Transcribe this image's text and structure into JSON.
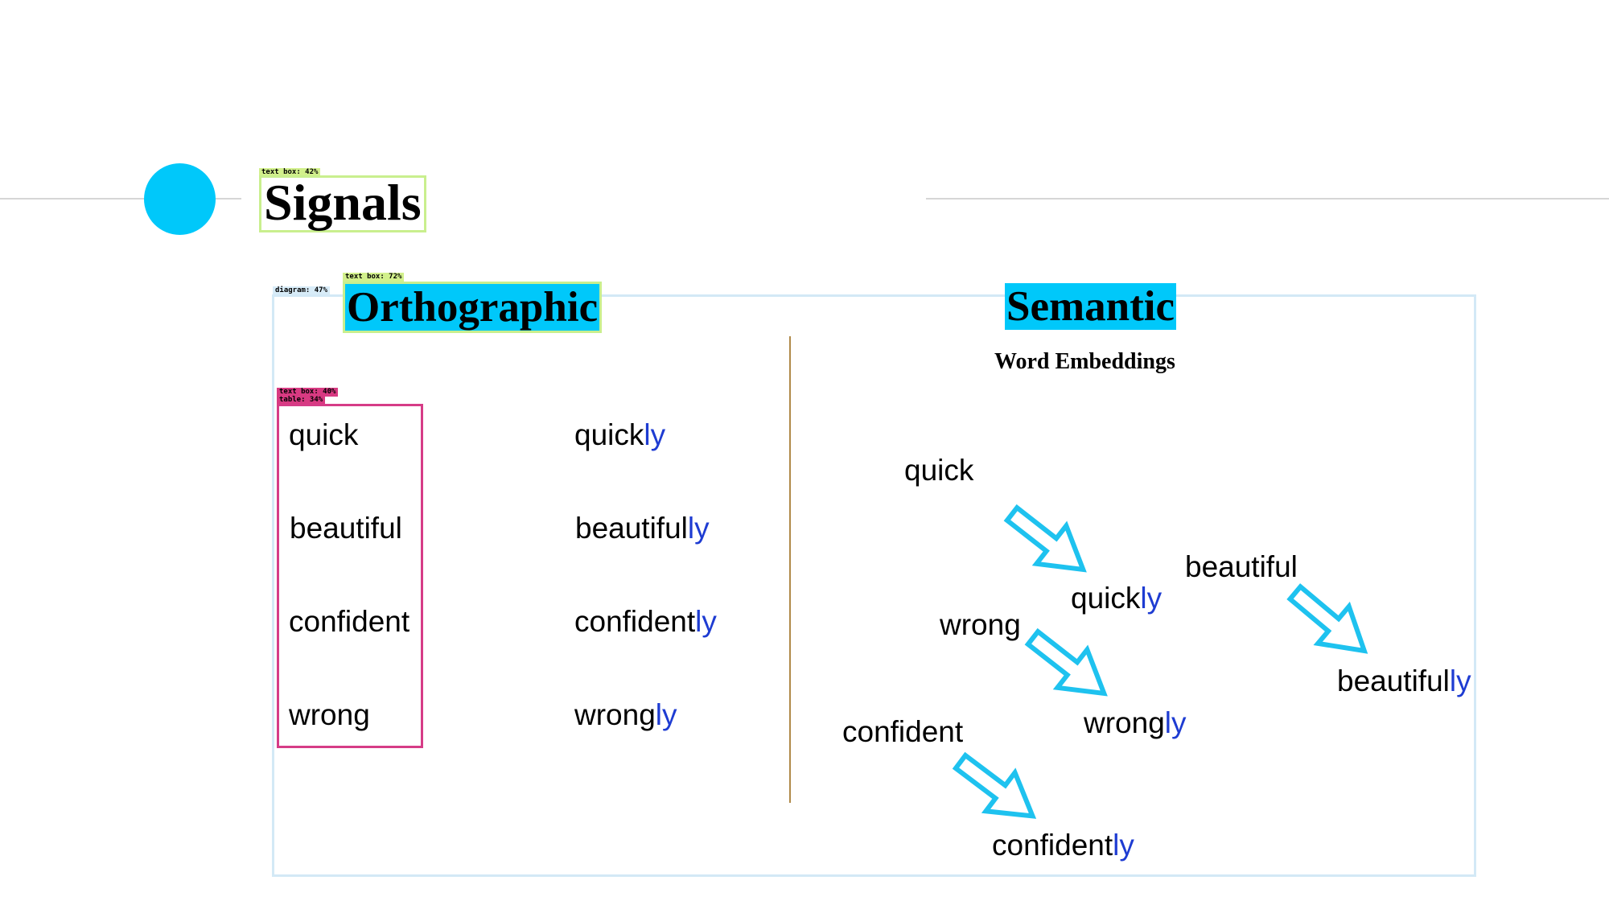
{
  "slide": {
    "title": "Signals",
    "detection_labels": {
      "title_box": "text box: 42%",
      "ortho_box": "text box: 72%",
      "diagram": "diagram: 47%",
      "table_text": "text box: 40%",
      "table": "table: 34%"
    },
    "orthographic": {
      "heading": "Orthographic",
      "base_words": [
        "quick",
        "beautiful",
        "confident",
        "wrong"
      ],
      "derived": [
        {
          "base": "quick",
          "suffix": "ly"
        },
        {
          "base": "beautiful",
          "suffix": "ly"
        },
        {
          "base": "confident",
          "suffix": "ly"
        },
        {
          "base": "wrong",
          "suffix": "ly"
        }
      ]
    },
    "semantic": {
      "heading": "Semantic",
      "subtitle": "Word Embeddings",
      "pairs": [
        {
          "source": "quick",
          "target_base": "quick",
          "target_suffix": "ly"
        },
        {
          "source": "beautiful",
          "target_base": "beautiful",
          "target_suffix": "ly"
        },
        {
          "source": "wrong",
          "target_base": "wrong",
          "target_suffix": "ly"
        },
        {
          "source": "confident",
          "target_base": "confident",
          "target_suffix": "ly"
        }
      ]
    },
    "colors": {
      "accent": "#00c8fa",
      "suffix": "#1e3cd2",
      "table_border": "#d63c87",
      "text_box_border": "#c9ef8e",
      "diagram_border": "#d3e9f6"
    }
  }
}
